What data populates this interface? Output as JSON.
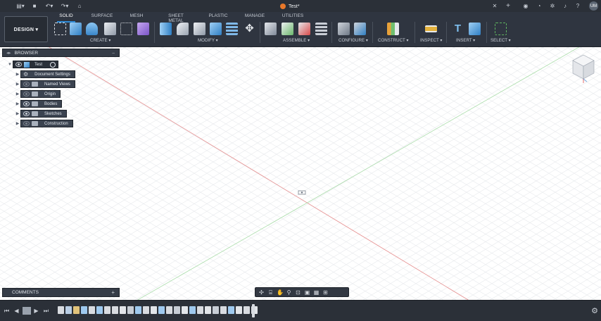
{
  "window": {
    "document_title": "Test*",
    "user_initials": "UM"
  },
  "ribbon": {
    "workspace_button": "DESIGN ▾",
    "tabs": [
      "SOLID",
      "SURFACE",
      "MESH",
      "SHEET METAL",
      "PLASTIC",
      "MANAGE",
      "UTILITIES"
    ],
    "active_tab": "SOLID",
    "groups": [
      "CREATE ▾",
      "MODIFY ▾",
      "ASSEMBLE ▾",
      "CONFIGURE ▾",
      "CONSTRUCT ▾",
      "INSPECT ▾",
      "INSERT ▾",
      "SELECT ▾"
    ]
  },
  "browser": {
    "title": "BROWSER",
    "root_label": "Test",
    "items": [
      {
        "label": "Document Settings",
        "icon": "gear-icon",
        "visible": false
      },
      {
        "label": "Named Views",
        "icon": "folder-icon",
        "visible": false
      },
      {
        "label": "Origin",
        "icon": "folder-icon",
        "visible": false
      },
      {
        "label": "Bodies",
        "icon": "folder-icon",
        "visible": true
      },
      {
        "label": "Sketches",
        "icon": "folder-icon",
        "visible": true
      },
      {
        "label": "Construction",
        "icon": "folder-icon",
        "visible": false
      }
    ]
  },
  "comments": {
    "title": "COMMENTS",
    "add_symbol": "+"
  },
  "colors": {
    "accent": "#2f8bd6",
    "ribbon_bg": "#2f3540",
    "x_axis": "#e06060",
    "y_axis": "#7fcf7f"
  }
}
